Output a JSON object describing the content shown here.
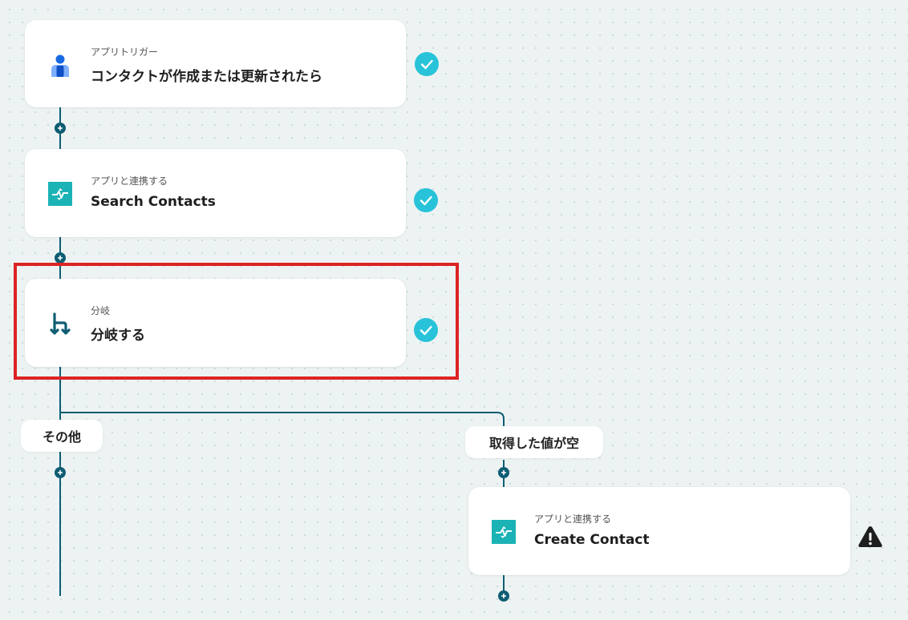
{
  "colors": {
    "line": "#0e5d73",
    "check": "#28c3d9",
    "highlight": "#dc2323",
    "teal_app": "#1bb3b5",
    "trigger_blue": "#1769e0",
    "warning": "#1e1e1e"
  },
  "steps": [
    {
      "subtitle": "アプリトリガー",
      "title": "コンタクトが作成または更新されたら",
      "icon": "person-icon",
      "status": "check-icon"
    },
    {
      "subtitle": "アプリと連携する",
      "title": "Search Contacts",
      "icon": "app-logo-icon",
      "status": "check-icon"
    },
    {
      "subtitle": "分岐",
      "title": "分岐する",
      "icon": "branch-icon",
      "status": "check-icon"
    },
    {
      "subtitle": "アプリと連携する",
      "title": "Create Contact",
      "icon": "app-logo-icon",
      "status": "warning-icon"
    }
  ],
  "branches": {
    "left": "その他",
    "right": "取得した値が空"
  }
}
